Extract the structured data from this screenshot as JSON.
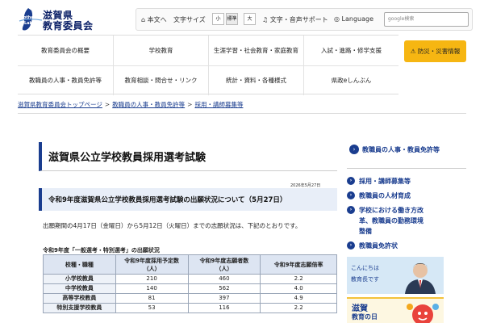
{
  "header": {
    "logo_line1": "滋賀県",
    "logo_line2": "教育委員会",
    "logo_en_mother": "Mother",
    "logo_en_lake": "Lake",
    "skip_link": "本文へ",
    "font_size_label": "文字サイズ",
    "font_small": "小",
    "font_standard": "標準",
    "font_large": "大",
    "speech_support": "文字・音声サポート",
    "language": "Language",
    "search_placeholder": "google検索"
  },
  "nav": {
    "row1": [
      "教育委員会の概要",
      "学校教育",
      "生涯学習・社会教育・家庭教育",
      "入試・進路・修学支援"
    ],
    "row2": [
      "教職員の人事・教員免許等",
      "教育相談・問合せ・リンク",
      "統計・資料・各種様式",
      "県政eしんぶん"
    ],
    "disaster": "防災・災害情報"
  },
  "breadcrumb": [
    "滋賀県教育委員会トップページ",
    "教職員の人事・教員免許等",
    "採用・講師募集等"
  ],
  "main": {
    "title": "滋賀県公立学校教員採用選考試験",
    "date": "2026年5月27日",
    "subtitle": "令和9年度滋賀県公立学校教員採用選考試験の出願状況について（5月27日）",
    "paragraph": "出願期間の4月17日（金曜日）から5月12日（火曜日）までの志願状況は、下記のとおりです。",
    "table_caption": "令和9年度「一般選考・特別選考」の出願状況",
    "table": {
      "headers": [
        "校種・職種",
        "令和9年度採用予定数\n（人）",
        "令和9年度志願者数\n（人）",
        "令和9年度志願倍率"
      ],
      "rows": [
        [
          "小学校教員",
          "210",
          "460",
          "2.2"
        ],
        [
          "中学校教員",
          "140",
          "562",
          "4.0"
        ],
        [
          "高等学校教員",
          "81",
          "397",
          "4.9"
        ],
        [
          "特別支援学校教員",
          "53",
          "116",
          "2.2"
        ]
      ]
    }
  },
  "sidebar": {
    "heading": "教職員の人事・教員免許等",
    "items": [
      "採用・講師募集等",
      "教職員の人材育成",
      "学校における働き方改革、教職員の勤務環境整備",
      "教職員免許状"
    ],
    "item3_lines": [
      "学校における働き方改",
      "革、教職員の勤務環境",
      "整備"
    ],
    "banner1_line1": "こんにちは",
    "banner1_line2": "教育長です",
    "banner2_line1": "滋賀",
    "banner2_line2": "教育の日"
  },
  "colors": {
    "accent": "#1a3d8f",
    "disaster": "#f6b612",
    "subtitle_bg": "#e8eef8"
  }
}
